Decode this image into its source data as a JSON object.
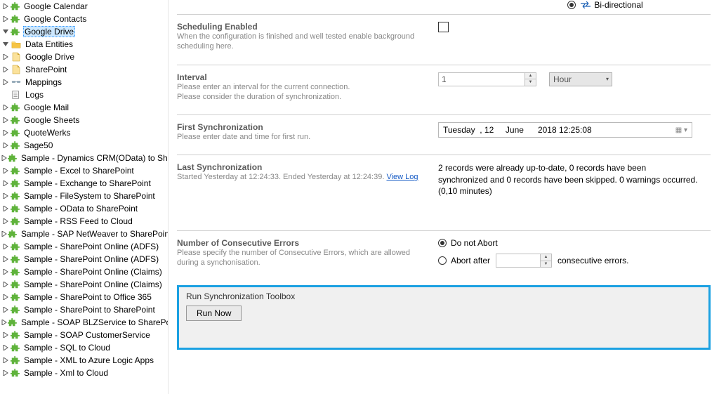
{
  "top_option_label": "Bi-directional",
  "sidebar": {
    "items": [
      {
        "label": "Google Calendar",
        "icon": "puzzle",
        "indent": 0,
        "expander": "right"
      },
      {
        "label": "Google Contacts",
        "icon": "puzzle",
        "indent": 0,
        "expander": "right"
      },
      {
        "label": "Google Drive",
        "icon": "puzzle",
        "indent": 0,
        "expander": "down",
        "selected": true
      },
      {
        "label": "Data Entities",
        "icon": "folder",
        "indent": 1,
        "expander": "down"
      },
      {
        "label": "Google Drive",
        "icon": "page",
        "indent": 2,
        "expander": "right"
      },
      {
        "label": "SharePoint",
        "icon": "page",
        "indent": 2,
        "expander": "right"
      },
      {
        "label": "Mappings",
        "icon": "link",
        "indent": 1,
        "expander": "right"
      },
      {
        "label": "Logs",
        "icon": "log",
        "indent": 1,
        "expander": "none"
      },
      {
        "label": "Google Mail",
        "icon": "puzzle",
        "indent": 0,
        "expander": "right"
      },
      {
        "label": "Google Sheets",
        "icon": "puzzle",
        "indent": 0,
        "expander": "right"
      },
      {
        "label": "QuoteWerks",
        "icon": "puzzle",
        "indent": 0,
        "expander": "right"
      },
      {
        "label": "Sage50",
        "icon": "puzzle",
        "indent": 0,
        "expander": "right"
      },
      {
        "label": "Sample - Dynamics CRM(OData) to SharePoint",
        "icon": "puzzle",
        "indent": 0,
        "expander": "right"
      },
      {
        "label": "Sample - Excel to SharePoint",
        "icon": "puzzle",
        "indent": 0,
        "expander": "right"
      },
      {
        "label": "Sample - Exchange to SharePoint",
        "icon": "puzzle",
        "indent": 0,
        "expander": "right"
      },
      {
        "label": "Sample - FileSystem to SharePoint",
        "icon": "puzzle",
        "indent": 0,
        "expander": "right"
      },
      {
        "label": "Sample - OData to SharePoint",
        "icon": "puzzle",
        "indent": 0,
        "expander": "right"
      },
      {
        "label": "Sample - RSS Feed to Cloud",
        "icon": "puzzle",
        "indent": 0,
        "expander": "right"
      },
      {
        "label": "Sample - SAP NetWeaver to SharePoint",
        "icon": "puzzle",
        "indent": 0,
        "expander": "right"
      },
      {
        "label": "Sample - SharePoint Online (ADFS)",
        "icon": "puzzle",
        "indent": 0,
        "expander": "right"
      },
      {
        "label": "Sample - SharePoint Online (ADFS)",
        "icon": "puzzle",
        "indent": 0,
        "expander": "right"
      },
      {
        "label": "Sample - SharePoint Online (Claims)",
        "icon": "puzzle",
        "indent": 0,
        "expander": "right"
      },
      {
        "label": "Sample - SharePoint Online (Claims)",
        "icon": "puzzle",
        "indent": 0,
        "expander": "right"
      },
      {
        "label": "Sample - SharePoint to Office 365",
        "icon": "puzzle",
        "indent": 0,
        "expander": "right"
      },
      {
        "label": "Sample - SharePoint to SharePoint",
        "icon": "puzzle",
        "indent": 0,
        "expander": "right"
      },
      {
        "label": "Sample - SOAP BLZService to SharePoint",
        "icon": "puzzle",
        "indent": 0,
        "expander": "right"
      },
      {
        "label": "Sample - SOAP CustomerService",
        "icon": "puzzle",
        "indent": 0,
        "expander": "right"
      },
      {
        "label": "Sample - SQL to Cloud",
        "icon": "puzzle",
        "indent": 0,
        "expander": "right"
      },
      {
        "label": "Sample - XML to Azure Logic Apps",
        "icon": "puzzle",
        "indent": 0,
        "expander": "right"
      },
      {
        "label": "Sample - Xml to Cloud",
        "icon": "puzzle",
        "indent": 0,
        "expander": "right"
      }
    ]
  },
  "scheduling": {
    "title": "Scheduling Enabled",
    "desc": "When the configuration is finished and well tested enable background scheduling here."
  },
  "interval": {
    "title": "Interval",
    "desc1": "Please enter an interval for the current connection.",
    "desc2": "Please consider the duration of synchronization.",
    "value": "1",
    "unit": "Hour"
  },
  "first_sync": {
    "title": "First Synchronization",
    "desc": "Please enter date and time for first run.",
    "value": "Tuesday  , 12     June      2018 12:25:08"
  },
  "last_sync": {
    "title": "Last Synchronization",
    "desc_prefix": "Started  Yesterday at 12:24:33. Ended Yesterday at 12:24:39. ",
    "link": "View Log",
    "status": "2 records were already up-to-date, 0 records have been synchronized and 0 records have been skipped. 0 warnings occurred. (0,10 minutes)"
  },
  "errors": {
    "title": "Number of Consecutive Errors",
    "desc": "Please specify the number of Consecutive Errors, which are allowed during a synchonisation.",
    "opt_no_abort": "Do not Abort",
    "opt_abort_after": "Abort after",
    "suffix": "consecutive errors."
  },
  "runbox": {
    "title": "Run Synchronization Toolbox",
    "button": "Run Now"
  }
}
